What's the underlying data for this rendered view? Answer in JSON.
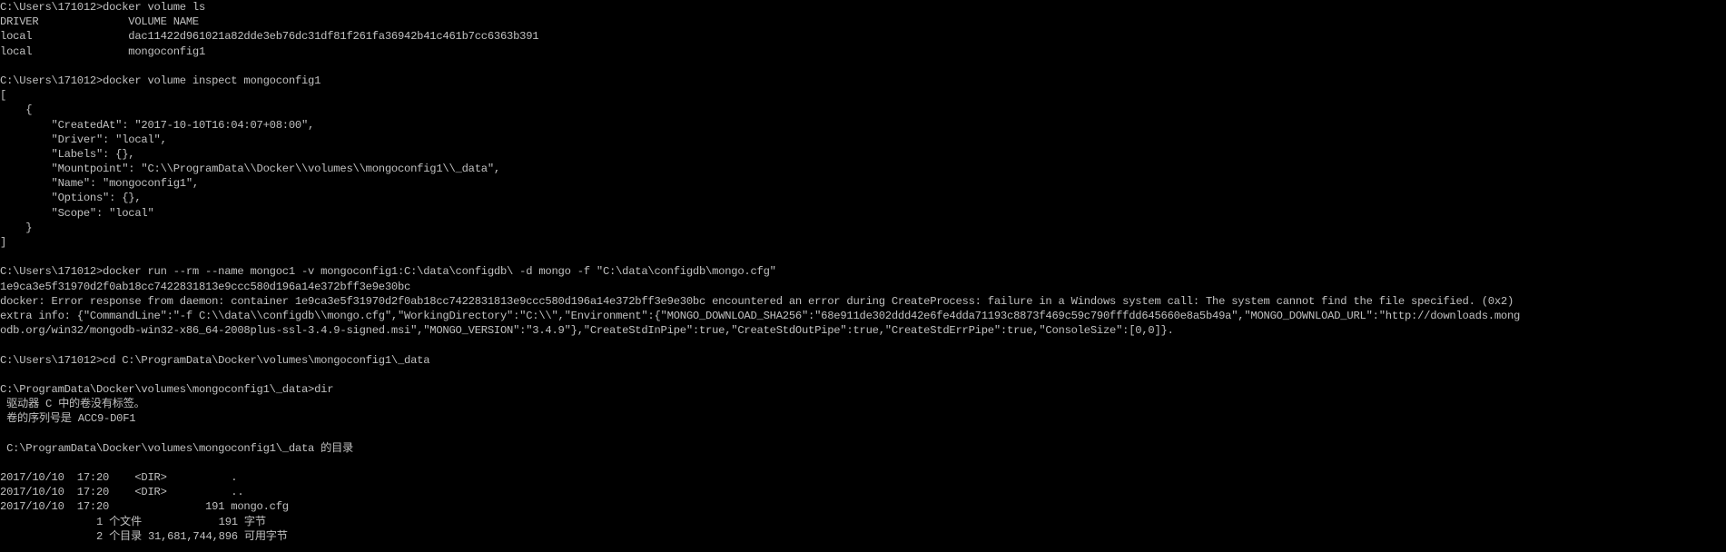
{
  "console": {
    "background": "#000000",
    "foreground": "#c0c0c0",
    "lines": [
      "C:\\Users\\171012>docker volume ls",
      "DRIVER              VOLUME NAME",
      "local               dac11422d961021a82dde3eb76dc31df81f261fa36942b41c461b7cc6363b391",
      "local               mongoconfig1",
      "",
      "C:\\Users\\171012>docker volume inspect mongoconfig1",
      "[",
      "    {",
      "        \"CreatedAt\": \"2017-10-10T16:04:07+08:00\",",
      "        \"Driver\": \"local\",",
      "        \"Labels\": {},",
      "        \"Mountpoint\": \"C:\\\\ProgramData\\\\Docker\\\\volumes\\\\mongoconfig1\\\\_data\",",
      "        \"Name\": \"mongoconfig1\",",
      "        \"Options\": {},",
      "        \"Scope\": \"local\"",
      "    }",
      "]",
      "",
      "C:\\Users\\171012>docker run --rm --name mongoc1 -v mongoconfig1:C:\\data\\configdb\\ -d mongo -f \"C:\\data\\configdb\\mongo.cfg\"",
      "1e9ca3e5f31970d2f0ab18cc7422831813e9ccc580d196a14e372bff3e9e30bc",
      "docker: Error response from daemon: container 1e9ca3e5f31970d2f0ab18cc7422831813e9ccc580d196a14e372bff3e9e30bc encountered an error during CreateProcess: failure in a Windows system call: The system cannot find the file specified. (0x2)",
      "extra info: {\"CommandLine\":\"-f C:\\\\data\\\\configdb\\\\mongo.cfg\",\"WorkingDirectory\":\"C:\\\\\",\"Environment\":{\"MONGO_DOWNLOAD_SHA256\":\"68e911de302ddd42e6fe4dda71193c8873f469c59c790fffdd645660e8a5b49a\",\"MONGO_DOWNLOAD_URL\":\"http://downloads.mong",
      "odb.org/win32/mongodb-win32-x86_64-2008plus-ssl-3.4.9-signed.msi\",\"MONGO_VERSION\":\"3.4.9\"},\"CreateStdInPipe\":true,\"CreateStdOutPipe\":true,\"CreateStdErrPipe\":true,\"ConsoleSize\":[0,0]}.",
      "",
      "C:\\Users\\171012>cd C:\\ProgramData\\Docker\\volumes\\mongoconfig1\\_data",
      "",
      "C:\\ProgramData\\Docker\\volumes\\mongoconfig1\\_data>dir",
      " 驱动器 C 中的卷没有标签。",
      " 卷的序列号是 ACC9-D0F1",
      "",
      " C:\\ProgramData\\Docker\\volumes\\mongoconfig1\\_data 的目录",
      "",
      "2017/10/10  17:20    <DIR>          .",
      "2017/10/10  17:20    <DIR>          ..",
      "2017/10/10  17:20               191 mongo.cfg",
      "               1 个文件            191 字节",
      "               2 个目录 31,681,744,896 可用字节"
    ]
  }
}
